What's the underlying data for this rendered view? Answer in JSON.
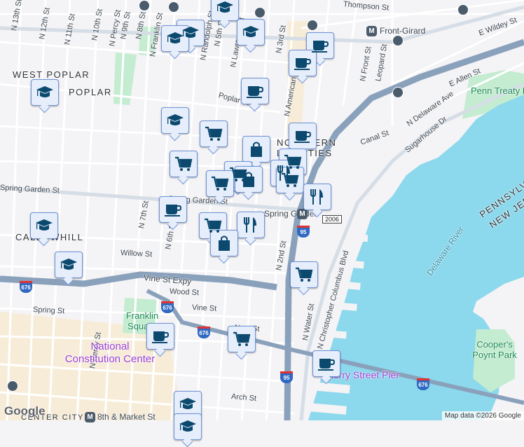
{
  "map": {
    "areas": [
      "WEST POPLAR",
      "POPLAR",
      "NORTHERN LIBERTIES",
      "CALLOWHILL",
      "CENTER CITY",
      "PENNSYLVANIA",
      "NEW JERSEY"
    ],
    "streets": [
      "N 13th St",
      "N 12th St",
      "N 11th St",
      "N 10th St",
      "N Percy St",
      "N 9th St",
      "N 8th St",
      "N Franklin St",
      "N Randolph St",
      "N 5th St",
      "N Lawrence St",
      "N American St",
      "N 3rd St",
      "N Front St",
      "Leopard St",
      "Thompson St",
      "E Wildey St",
      "E Allen St",
      "N Delaware Ave",
      "Sugarhouse Dr",
      "Canal St",
      "Poplar St",
      "Spring Garden St",
      "Willow St",
      "Vine St Expy",
      "Wood St",
      "Vine St",
      "Spring St",
      "New St",
      "Arch St",
      "N 7th St",
      "N 6th St",
      "N 2nd St",
      "N Water St",
      "N Christopher Columbus Blvd",
      "N Percy St"
    ],
    "parks": [
      "Penn Treaty Park",
      "Franklin Square",
      "Cooper's Poynt Park"
    ],
    "pois": [
      "National Constitution Center",
      "Cherry Street Pier"
    ],
    "water": "Delaware River",
    "stations": [
      "Front-Girard",
      "Spring Garden",
      "8th & Market St"
    ],
    "route_shields": [
      "676",
      "95",
      "2006"
    ],
    "attribution": "Map data ©2026 Google",
    "logo": "Google"
  },
  "marker_icons": [
    "graduation-cap",
    "coffee-cup",
    "shopping-cart",
    "shopping-bag",
    "restaurant"
  ],
  "colors": {
    "water": "#8cd8ec",
    "highway": "#8aa1bc",
    "marker_bg": "#e6edfb",
    "marker_border": "#6e95d8",
    "icon": "#0b4a6e",
    "park": "#c4ecd0"
  }
}
